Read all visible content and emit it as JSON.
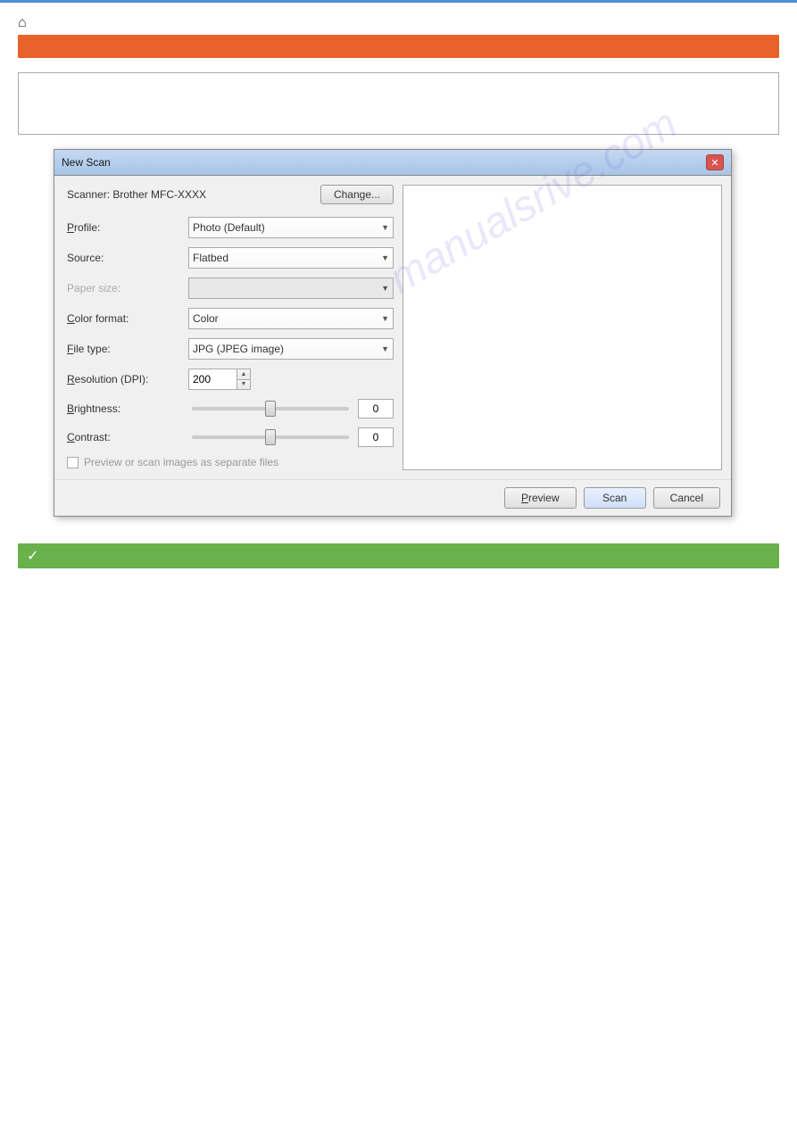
{
  "page": {
    "top_line_color": "#4a90d9",
    "section_bar_color": "#e8622a",
    "bottom_bar_color": "#6ab04c"
  },
  "info_box": {
    "text_line1": "",
    "text_line2": ""
  },
  "dialog": {
    "title": "New Scan",
    "close_label": "✕",
    "scanner_label": "Scanner: Brother MFC-XXXX",
    "change_button": "Change...",
    "profile_label": "Pro̲file:",
    "profile_value": "Photo (Default)",
    "source_label": "Source:",
    "source_value": "Flatbed",
    "paper_size_label": "Paper size:",
    "paper_size_value": "",
    "color_format_label": "C̲olor format:",
    "color_format_value": "Color",
    "file_type_label": "F̲ile type:",
    "file_type_value": "JPG (JPEG image)",
    "resolution_label": "R̲esolution (DPI):",
    "resolution_value": "200",
    "brightness_label": "B̲rightness:",
    "brightness_value": "0",
    "contrast_label": "C̲ontrast:",
    "contrast_value": "0",
    "checkbox_label": "Preview or scan images as separate files",
    "preview_button": "P̲review",
    "scan_button": "Scan",
    "cancel_button": "Cancel",
    "watermark": "manualsrive.com"
  }
}
